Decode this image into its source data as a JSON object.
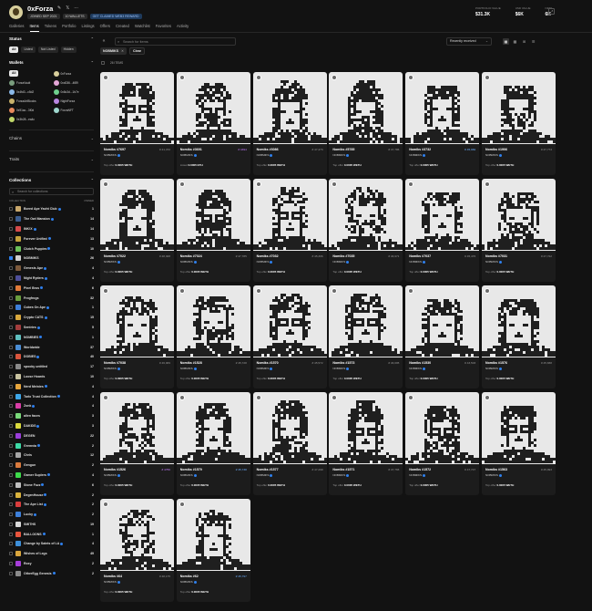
{
  "header": {
    "username": "0xForza",
    "joined": "JOINED SEP 2021",
    "wallets_label": "10 WALLETS",
    "badge": "GET CLAIMED WEB3 REWARD",
    "stats": [
      {
        "label": "PORTFOLIO VALUE",
        "value": "$31.3K"
      },
      {
        "label": "USD VALUE",
        "value": "$6K"
      },
      {
        "label": "NFTS",
        "value": "6K"
      }
    ]
  },
  "tabs": [
    "Galleries",
    "Items",
    "Tokens",
    "Portfolio",
    "Listings",
    "Offers",
    "Created",
    "Watchlist",
    "Favorites",
    "Activity"
  ],
  "sidebar": {
    "status_title": "Status",
    "status_chips": [
      "All",
      "Listed",
      "Not Listed",
      "Hidden"
    ],
    "wallets_title": "Wallets",
    "wallets": [
      {
        "name": "All",
        "color": "#2a2a2a"
      },
      {
        "name": "0xForza",
        "color": "#d8cf9c"
      },
      {
        "name": "ForzaVault",
        "color": "#7a9e7e"
      },
      {
        "name": "0xd036...4f89",
        "color": "#e3a6d6"
      },
      {
        "name": "0x4fd3...c5d2",
        "color": "#8bb9e8"
      },
      {
        "name": "0x8c3d...1b7e",
        "color": "#6ed08d"
      },
      {
        "name": "ForzaArtBlocks",
        "color": "#c9b26b"
      },
      {
        "name": "NightForza",
        "color": "#b886e0"
      },
      {
        "name": "0x91ac...3f0d",
        "color": "#e88a5c"
      },
      {
        "name": "ForzaNFT",
        "color": "#9fd8cf"
      },
      {
        "name": "0x3b28...ea4c",
        "color": "#c2d96a"
      }
    ],
    "chains_title": "Chains",
    "traits_title": "Traits",
    "collections_title": "Collections",
    "collection_search_placeholder": "Search for collections",
    "col_header_left": "COLLECTION",
    "col_header_right": "OWNED",
    "collections": [
      {
        "name": "Bored Ape Yacht Club",
        "count": "1",
        "color": "#c8a76b",
        "checked": false,
        "verified": true
      },
      {
        "name": "The Owl Mansion",
        "count": "14",
        "color": "#3b5c8f",
        "checked": false,
        "verified": true
      },
      {
        "name": "INK!X",
        "count": "14",
        "color": "#d44a4a",
        "checked": false,
        "verified": true
      },
      {
        "name": "Forever Unified",
        "count": "13",
        "color": "#c4a23b",
        "checked": false,
        "verified": true
      },
      {
        "name": "Clutch Puppies",
        "count": "10",
        "color": "#6bbf58",
        "checked": false,
        "verified": true
      },
      {
        "name": "NOBMIKS",
        "count": "26",
        "color": "#d0d0d0",
        "checked": true,
        "verified": false
      },
      {
        "name": "Genesis Ape",
        "count": "4",
        "color": "#7d5a3c",
        "checked": false,
        "verified": true
      },
      {
        "name": "Night Ryders",
        "count": "4",
        "color": "#4f4f9a",
        "checked": false,
        "verified": true
      },
      {
        "name": "Pixel Bros",
        "count": "6",
        "color": "#e07a3a",
        "checked": false,
        "verified": true
      },
      {
        "name": "Frogfrogs",
        "count": "32",
        "color": "#6a9d3e",
        "checked": false,
        "verified": false
      },
      {
        "name": "Cubes On Ape",
        "count": "1",
        "color": "#3d7fd9",
        "checked": false,
        "verified": true
      },
      {
        "name": "Crypto CATS",
        "count": "15",
        "color": "#d9a83d",
        "checked": false,
        "verified": true
      },
      {
        "name": "Sentries",
        "count": "5",
        "color": "#a33d3d",
        "checked": false,
        "verified": true
      },
      {
        "name": "NOMBIES",
        "count": "1",
        "color": "#5fbfbf",
        "checked": false,
        "verified": true
      },
      {
        "name": "Worldwide",
        "count": "37",
        "color": "#4a8dd4",
        "checked": false,
        "verified": false
      },
      {
        "name": "DOBIES",
        "count": "40",
        "color": "#d9553d",
        "checked": false,
        "verified": true
      },
      {
        "name": "spooky untitled",
        "count": "17",
        "color": "#8a8a8a",
        "checked": false,
        "verified": false
      },
      {
        "name": "Loose Hoards",
        "count": "10",
        "color": "#c9c3a0",
        "checked": false,
        "verified": false
      },
      {
        "name": "Nerd Meinies",
        "count": "4",
        "color": "#e8a63d",
        "checked": false,
        "verified": true
      },
      {
        "name": "Tarlo Trust Collection",
        "count": "4",
        "color": "#3da6e8",
        "checked": false,
        "verified": true
      },
      {
        "name": "Zonk",
        "count": "4",
        "color": "#d93da6",
        "checked": false,
        "verified": true
      },
      {
        "name": "alien faces",
        "count": "3",
        "color": "#7ad97a",
        "checked": false,
        "verified": false
      },
      {
        "name": "DAKIDS",
        "count": "3",
        "color": "#d9d93d",
        "checked": false,
        "verified": true
      },
      {
        "name": "DEGEN",
        "count": "22",
        "color": "#9a3dd9",
        "checked": false,
        "verified": false
      },
      {
        "name": "Gremvia",
        "count": "2",
        "color": "#3dd9a6",
        "checked": false,
        "verified": true
      },
      {
        "name": "Chris",
        "count": "12",
        "color": "#a6a6a6",
        "checked": false,
        "verified": false
      },
      {
        "name": "Gengun",
        "count": "2",
        "color": "#d97a3d",
        "checked": false,
        "verified": false
      },
      {
        "name": "Gamer Suplers",
        "count": "4",
        "color": "#3dd94a",
        "checked": false,
        "verified": true
      },
      {
        "name": "Stone Fuzz",
        "count": "6",
        "color": "#bfbfbf",
        "checked": false,
        "verified": true
      },
      {
        "name": "DegenHouse",
        "count": "2",
        "color": "#d9b23d",
        "checked": false,
        "verified": true
      },
      {
        "name": "The Ape List",
        "count": "2",
        "color": "#d93d3d",
        "checked": false,
        "verified": true
      },
      {
        "name": "Lucky",
        "count": "2",
        "color": "#3d7fd9",
        "checked": false,
        "verified": true
      },
      {
        "name": "SMITHS",
        "count": "19",
        "color": "#d9d9d9",
        "checked": false,
        "verified": false
      },
      {
        "name": "BALLOONS",
        "count": "1",
        "color": "#e8553d",
        "checked": false,
        "verified": true
      },
      {
        "name": "Change by Saints of LA",
        "count": "4",
        "color": "#3d8fd9",
        "checked": false,
        "verified": true
      },
      {
        "name": "Wishes of Legs",
        "count": "49",
        "color": "#d9a63d",
        "checked": false,
        "verified": false
      },
      {
        "name": "Roxy",
        "count": "2",
        "color": "#a63dd9",
        "checked": false,
        "verified": false
      },
      {
        "name": "OtherEgg Genesis",
        "count": "2",
        "color": "#8a8a8a",
        "checked": false,
        "verified": true
      }
    ]
  },
  "toolbar": {
    "search_placeholder": "Search for items",
    "sort_label": "Recently received",
    "active_filter": "NOBMIKS",
    "clear_label": "Clear",
    "items_count": "26 ITEMS",
    "view_icons": [
      "grid-large",
      "grid-medium",
      "grid-small",
      "list"
    ]
  },
  "cards": [
    {
      "name": "Nomiks #7697",
      "rank": "# 41,472",
      "rank_color": "gray",
      "sub": "NOBMIKS",
      "price_label": "Top offer",
      "price": "0.0005 WETH"
    },
    {
      "name": "Nomiks #3691",
      "rank": "# 4394",
      "rank_color": "purple",
      "sub": "NOBMIKS",
      "price_label": "Listed",
      "price": "0.0005 ETH"
    },
    {
      "name": "Nomiks #3086",
      "rank": "# 47,473",
      "rank_color": "gray",
      "sub": "NOBMIKS",
      "price_label": "Top offer",
      "price": "0.0005 WETH"
    },
    {
      "name": "Nomiks #5785",
      "rank": "# 47,786",
      "rank_color": "gray",
      "sub": "NOBMIKS",
      "price_label": "Top offer",
      "price": "0.0005 WETH"
    },
    {
      "name": "Nomiks #3732",
      "rank": "# 45,982",
      "rank_color": "blue",
      "sub": "NOBMIKS",
      "price_label": "Top offer",
      "price": "0.0005 WETH"
    },
    {
      "name": "Nomiks #1906",
      "rank": "# 47,773",
      "rank_color": "gray",
      "sub": "NOBMIKS",
      "price_label": "Top offer",
      "price": "0.0005 WETH"
    },
    {
      "name": "Nomiks #7022",
      "rank": "# 48,308",
      "rank_color": "gray",
      "sub": "NOBMIKS",
      "price_label": "Top offer",
      "price": "0.0005 WETH"
    },
    {
      "name": "Nomiks #7024",
      "rank": "# 47,785",
      "rank_color": "gray",
      "sub": "NOBMIKS",
      "price_label": "Top offer",
      "price": "0.0005 WETH"
    },
    {
      "name": "Nomiks #7032",
      "rank": "# 45,306",
      "rank_color": "gray",
      "sub": "NOBMIKS",
      "price_label": "Top offer",
      "price": "0.0005 WETH"
    },
    {
      "name": "Nomiks #7035",
      "rank": "# 46,971",
      "rank_color": "gray",
      "sub": "NOBMIKS",
      "price_label": "Top offer",
      "price": "0.0005 WETH"
    },
    {
      "name": "Nomiks #7037",
      "rank": "# 45,476",
      "rank_color": "gray",
      "sub": "NOBMIKS",
      "price_label": "Top offer",
      "price": "0.0005 WETH"
    },
    {
      "name": "Nomiks #7031",
      "rank": "# 47,722",
      "rank_color": "gray",
      "sub": "NOBMIKS",
      "price_label": "Top offer",
      "price": "0.0005 WETH"
    },
    {
      "name": "Nomiks #7038",
      "rank": "# 46,969",
      "rank_color": "gray",
      "sub": "NOBMIKS",
      "price_label": "Top offer",
      "price": "0.0005 WETH"
    },
    {
      "name": "Nomiks #1528",
      "rank": "# 45,728",
      "rank_color": "gray",
      "sub": "NOBMIKS",
      "price_label": "Top offer",
      "price": "0.0005 WETH"
    },
    {
      "name": "Nomiks #1570",
      "rank": "# 45,572",
      "rank_color": "gray",
      "sub": "NOBMIKS",
      "price_label": "Top offer",
      "price": "0.0005 WETH"
    },
    {
      "name": "Nomiks #1573",
      "rank": "# 46,695",
      "rank_color": "gray",
      "sub": "NOBMIKS",
      "price_label": "Top offer",
      "price": "0.0005 WETH"
    },
    {
      "name": "Nomiks #1530",
      "rank": "# 43,503",
      "rank_color": "gray",
      "sub": "NOBMIKS",
      "price_label": "Top offer",
      "price": "0.0005 WETH"
    },
    {
      "name": "Nomiks #1576",
      "rank": "# 45,838",
      "rank_color": "gray",
      "sub": "NOBMIKS",
      "price_label": "Top offer",
      "price": "0.0005 WETH"
    },
    {
      "name": "Nomiks #1526",
      "rank": "# 4756",
      "rank_color": "purple",
      "sub": "NOBMIKS",
      "price_label": "Top offer",
      "price": "0.0005 WETH"
    },
    {
      "name": "Nomiks #1579",
      "rank": "# 45,738",
      "rank_color": "blue",
      "sub": "NOBMIKS",
      "price_label": "Top offer",
      "price": "0.0005 WETH"
    },
    {
      "name": "Nomiks #1577",
      "rank": "# 47,299",
      "rank_color": "gray",
      "sub": "NOBMIKS",
      "price_label": "Top offer",
      "price": "0.0005 WETH"
    },
    {
      "name": "Nomiks #1571",
      "rank": "# 47,765",
      "rank_color": "gray",
      "sub": "NOBMIKS",
      "price_label": "Top offer",
      "price": "0.0005 WETH"
    },
    {
      "name": "Nomiks #1572",
      "rank": "# 47,747",
      "rank_color": "gray",
      "sub": "NOBMIKS",
      "price_label": "Top offer",
      "price": "0.0005 WETH"
    },
    {
      "name": "Nomiks #1563",
      "rank": "# 45,993",
      "rank_color": "gray",
      "sub": "NOBMIKS",
      "price_label": "Top offer",
      "price": "0.0005 WETH"
    },
    {
      "name": "Nomiks #64",
      "rank": "# 48,175",
      "rank_color": "gray",
      "sub": "NOBMIKS",
      "price_label": "Top offer",
      "price": "0.0005 WETH"
    },
    {
      "name": "Nomiks #62",
      "rank": "# 45,797",
      "rank_color": "blue",
      "sub": "NOBMIKS",
      "price_label": "Top offer",
      "price": "0.0005 WETH"
    }
  ]
}
